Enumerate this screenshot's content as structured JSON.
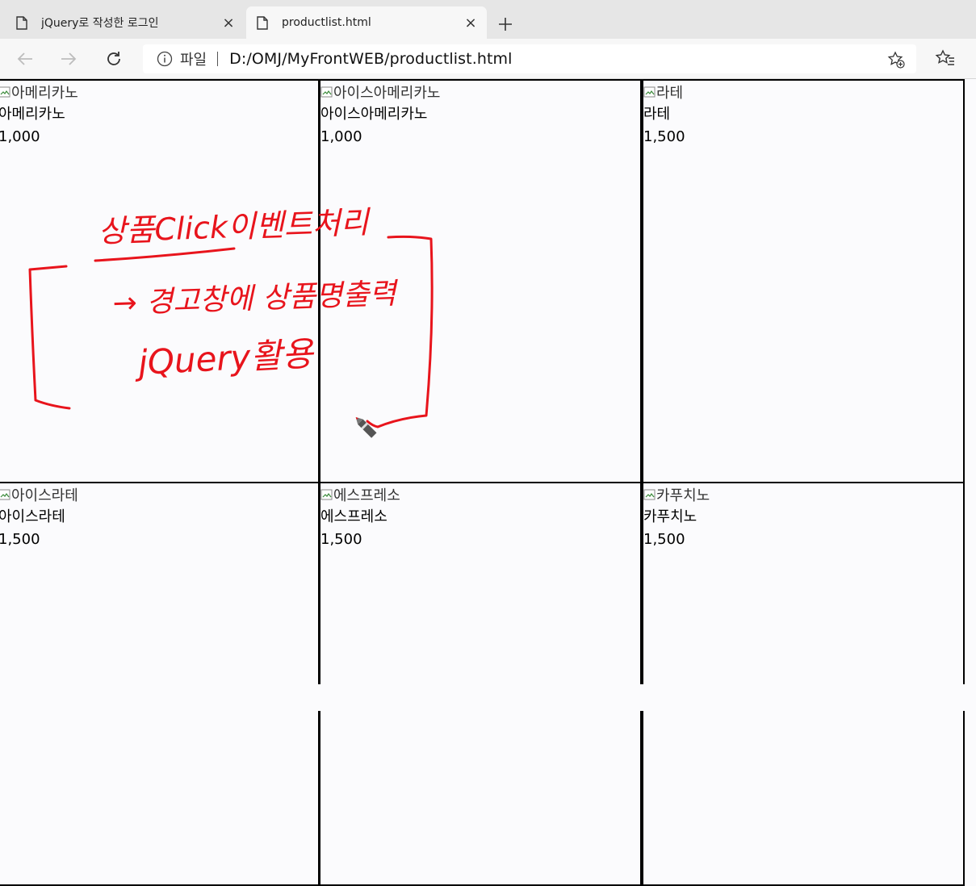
{
  "tabs": [
    {
      "title": "jQuery로 작성한 로그인",
      "close": "×"
    },
    {
      "title": "productlist.html",
      "close": "×"
    }
  ],
  "toolbar": {
    "file_label": "파일",
    "url": "D:/OMJ/MyFrontWEB/productlist.html"
  },
  "products": [
    {
      "alt": "아메리카노",
      "name": "아메리카노",
      "price": "1,000"
    },
    {
      "alt": "아이스아메리카노",
      "name": "아이스아메리카노",
      "price": "1,000"
    },
    {
      "alt": "라테",
      "name": "라테",
      "price": "1,500"
    },
    {
      "alt": "아이스라테",
      "name": "아이스라테",
      "price": "1,500"
    },
    {
      "alt": "에스프레소",
      "name": "에스프레소",
      "price": "1,500"
    },
    {
      "alt": "카푸치노",
      "name": "카푸치노",
      "price": "1,500"
    }
  ],
  "annotation": {
    "line1": "상품Click이벤트처리",
    "line2": "→ 경고창에 상품명출력",
    "line3": "jQuery활용"
  },
  "colors": {
    "ink": "#e8141c",
    "cell_border": "#000000",
    "tab_bar": "#e6e6e6",
    "toolbar": "#f7f7f7"
  },
  "icons": [
    "page-icon",
    "close-icon",
    "new-tab-icon",
    "back-icon",
    "forward-icon",
    "refresh-icon",
    "info-icon",
    "add-favorite-icon",
    "favorites-icon",
    "broken-image-icon",
    "pen-cursor-icon"
  ]
}
